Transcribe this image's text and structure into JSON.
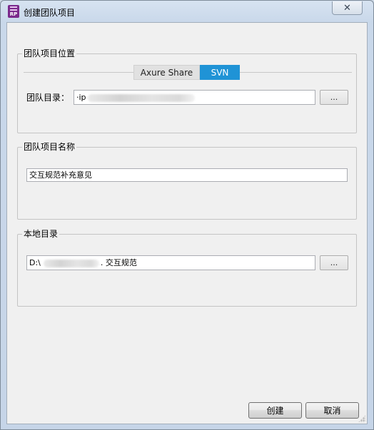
{
  "window": {
    "title": "创建团队项目",
    "app_icon_label": "RP",
    "close_glyph": "✕"
  },
  "location_group": {
    "label": "团队项目位置",
    "tabs": [
      {
        "label": "Axure Share",
        "selected": false
      },
      {
        "label": "SVN",
        "selected": true
      }
    ],
    "directory_label": "团队目录：",
    "directory_value_visible_prefix": "·ip",
    "browse_label": "..."
  },
  "name_group": {
    "label": "团队项目名称",
    "value": "交互规范补充意见"
  },
  "local_group": {
    "label": "本地目录",
    "path_prefix": "D:\\",
    "path_suffix": ". 交互规范",
    "browse_label": "..."
  },
  "buttons": {
    "create_label": "创建",
    "cancel_label": "取消"
  },
  "colors": {
    "selected_tab": "#1f93d6",
    "client_background": "#f0f0f0",
    "app_icon": "#7b2a8c"
  }
}
